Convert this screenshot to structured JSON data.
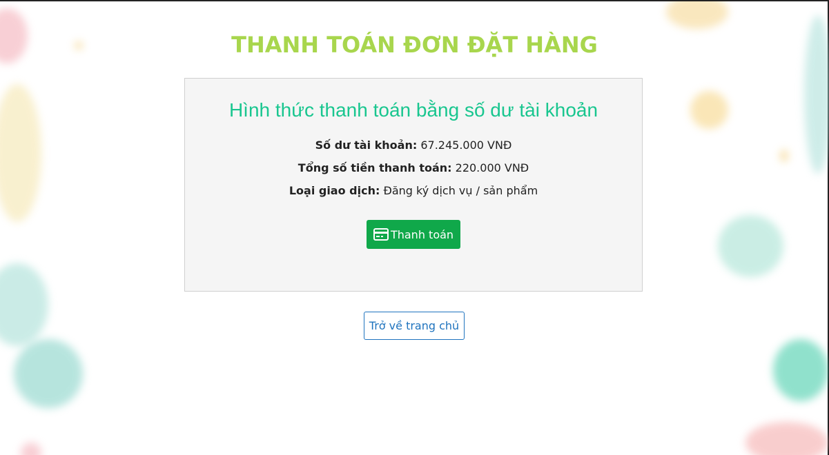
{
  "page": {
    "title": "THANH TOÁN ĐƠN ĐẶT HÀNG"
  },
  "card": {
    "title": "Hình thức thanh toán bằng số dư tài khoản",
    "rows": [
      {
        "label": "Số dư tài khoản:",
        "value": " 67.245.000 VNĐ"
      },
      {
        "label": "Tổng số tiền thanh toán:",
        "value": " 220.000 VNĐ"
      },
      {
        "label": "Loại giao dịch:",
        "value": " Đăng ký dịch vụ / sản phẩm"
      }
    ],
    "pay_button": {
      "label": "Thanh toán",
      "icon": "credit-card-icon"
    }
  },
  "home_button": {
    "label": "Trở về trang chủ"
  },
  "colors": {
    "title": "#a8d64d",
    "card_title": "#19c68f",
    "pay_button": "#10a84a",
    "home_button": "#1e73be"
  }
}
